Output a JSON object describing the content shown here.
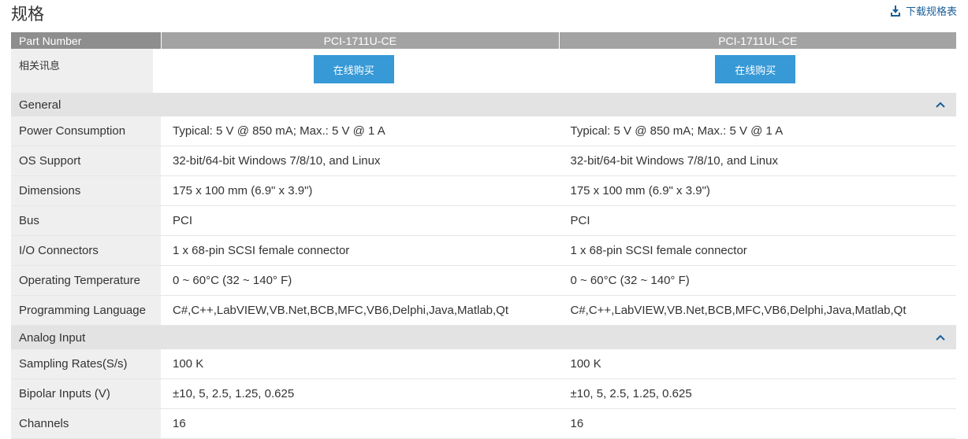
{
  "page": {
    "title": "规格",
    "download_label": "下载规格表"
  },
  "table": {
    "header_label": "Part Number",
    "models": [
      "PCI-1711U-CE",
      "PCI-1711UL-CE"
    ],
    "info_label": "相关讯息",
    "buy_label": "在线购买",
    "sections": [
      {
        "name": "General",
        "rows": [
          {
            "label": "Power Consumption",
            "values": [
              "Typical: 5 V @ 850 mA; Max.: 5 V @ 1 A",
              "Typical: 5 V @ 850 mA; Max.: 5 V @ 1 A"
            ]
          },
          {
            "label": "OS Support",
            "values": [
              "32-bit/64-bit Windows 7/8/10, and Linux",
              "32-bit/64-bit Windows 7/8/10, and Linux"
            ]
          },
          {
            "label": "Dimensions",
            "values": [
              "175 x 100 mm (6.9\" x 3.9\")",
              "175 x 100 mm (6.9\" x 3.9\")"
            ]
          },
          {
            "label": "Bus",
            "values": [
              "PCI",
              "PCI"
            ]
          },
          {
            "label": "I/O Connectors",
            "values": [
              "1 x 68-pin SCSI female connector",
              "1 x 68-pin SCSI female connector"
            ]
          },
          {
            "label": "Operating Temperature",
            "values": [
              "0 ~ 60°C (32 ~ 140° F)",
              "0 ~ 60°C (32 ~ 140° F)"
            ]
          },
          {
            "label": "Programming Language",
            "values": [
              "C#,C++,LabVIEW,VB.Net,BCB,MFC,VB6,Delphi,Java,Matlab,Qt",
              "C#,C++,LabVIEW,VB.Net,BCB,MFC,VB6,Delphi,Java,Matlab,Qt"
            ]
          }
        ]
      },
      {
        "name": "Analog Input",
        "rows": [
          {
            "label": "Sampling Rates(S/s)",
            "values": [
              "100 K",
              "100 K"
            ]
          },
          {
            "label": "Bipolar Inputs (V)",
            "values": [
              "±10, 5, 2.5, 1.25, 0.625",
              "±10, 5, 2.5, 1.25, 0.625"
            ]
          },
          {
            "label": "Channels",
            "values": [
              "16",
              "16"
            ]
          }
        ]
      }
    ]
  },
  "icons": {
    "download": "download-icon",
    "collapse": "chevron-up-icon"
  },
  "colors": {
    "accent": "#3799d6",
    "header_bg": "#a3a3a3",
    "section_bg": "#e3e3e3",
    "label_bg": "#efefef",
    "link": "#1a5f9a"
  }
}
